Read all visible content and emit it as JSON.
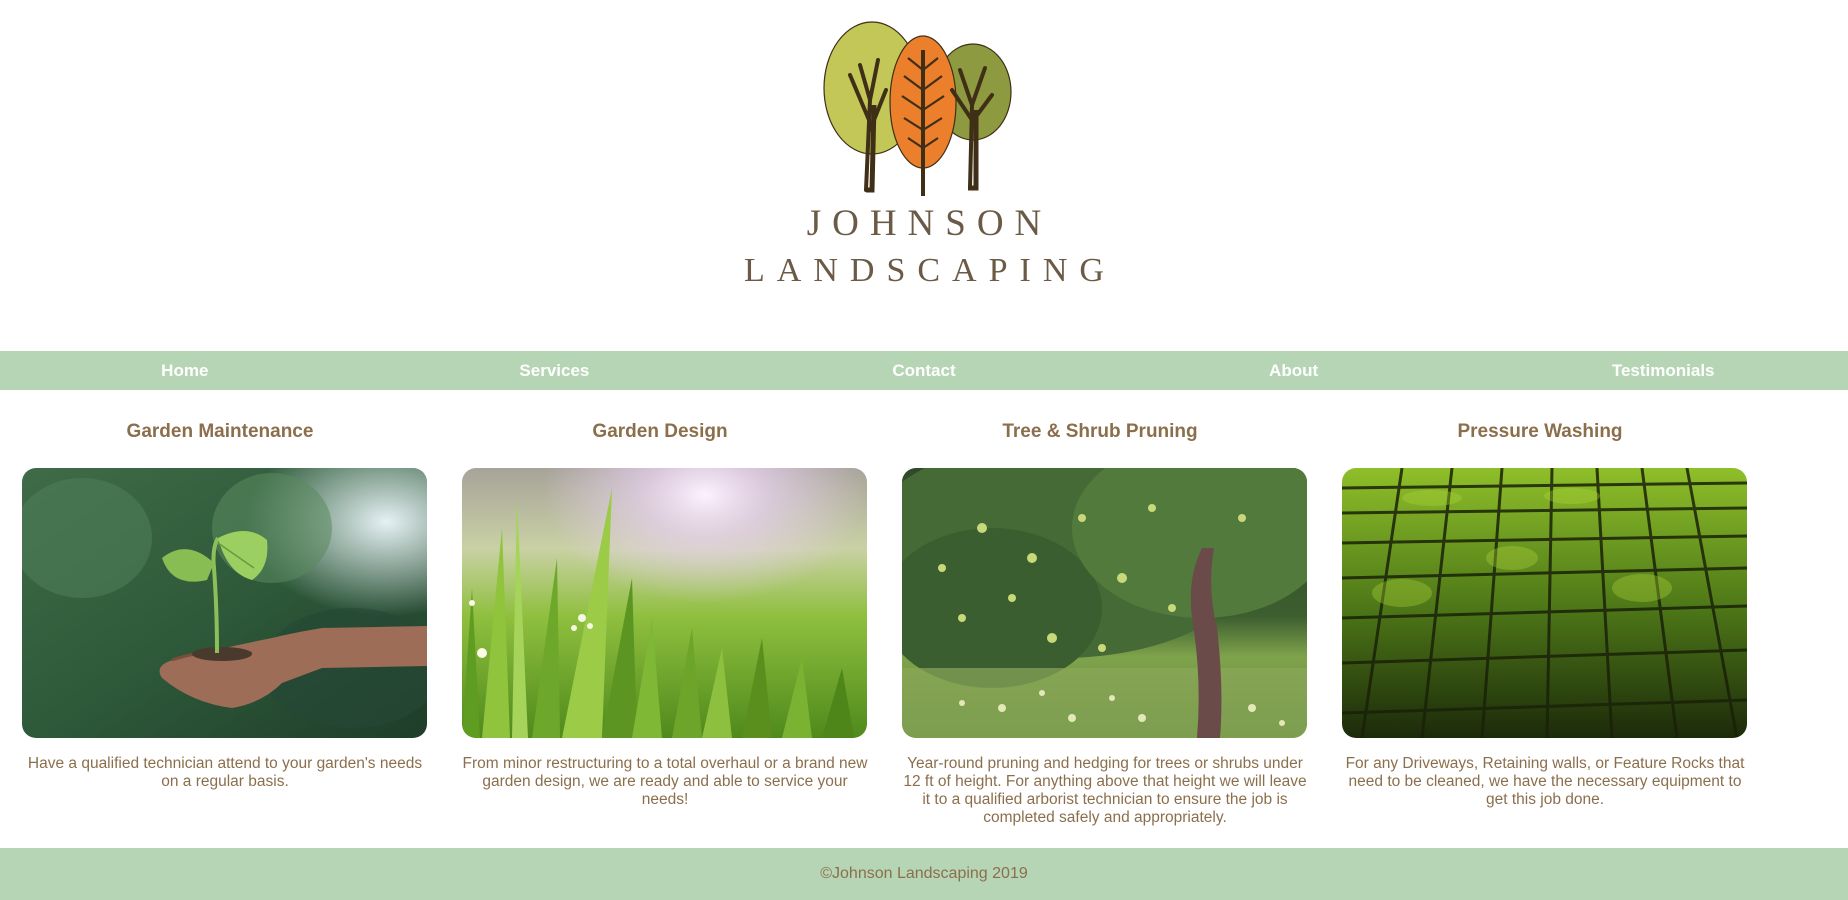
{
  "brand": {
    "line1": "JOHNSON",
    "line2": "LANDSCAPING",
    "logo_colors": {
      "light_green": "#c2c758",
      "orange": "#ec7f2c",
      "olive": "#8d9a40",
      "trunk": "#3f2f17",
      "text": "#6b5a45"
    }
  },
  "nav": {
    "items": [
      {
        "label": "Home"
      },
      {
        "label": "Services"
      },
      {
        "label": "Contact"
      },
      {
        "label": "About"
      },
      {
        "label": "Testimonials"
      }
    ],
    "background": "#b6d5b5"
  },
  "services": [
    {
      "title": "Garden Maintenance",
      "image": "seedling-in-hand-photo",
      "description": "Have a qualified technician attend to your garden's needs on a regular basis."
    },
    {
      "title": "Garden Design",
      "image": "sunlit-grass-photo",
      "description": "From minor restructuring to a total overhaul or a brand new garden design, we are ready and able to service your needs!"
    },
    {
      "title": "Tree & Shrub Pruning",
      "image": "apple-tree-photo",
      "description": "Year-round pruning and hedging for trees or shrubs under 12 ft of height. For anything above that height we will leave it to a qualified arborist technician to ensure the job is completed safely and appropriately."
    },
    {
      "title": "Pressure Washing",
      "image": "mossy-pavers-photo",
      "description": "For any Driveways, Retaining walls, or Feature Rocks that need to be cleaned, we have the necessary equipment to get this job done."
    }
  ],
  "footer": {
    "text": "©Johnson Landscaping 2019"
  },
  "colors": {
    "accent_green": "#b6d5b5",
    "text_brown": "#8b6f4c"
  }
}
